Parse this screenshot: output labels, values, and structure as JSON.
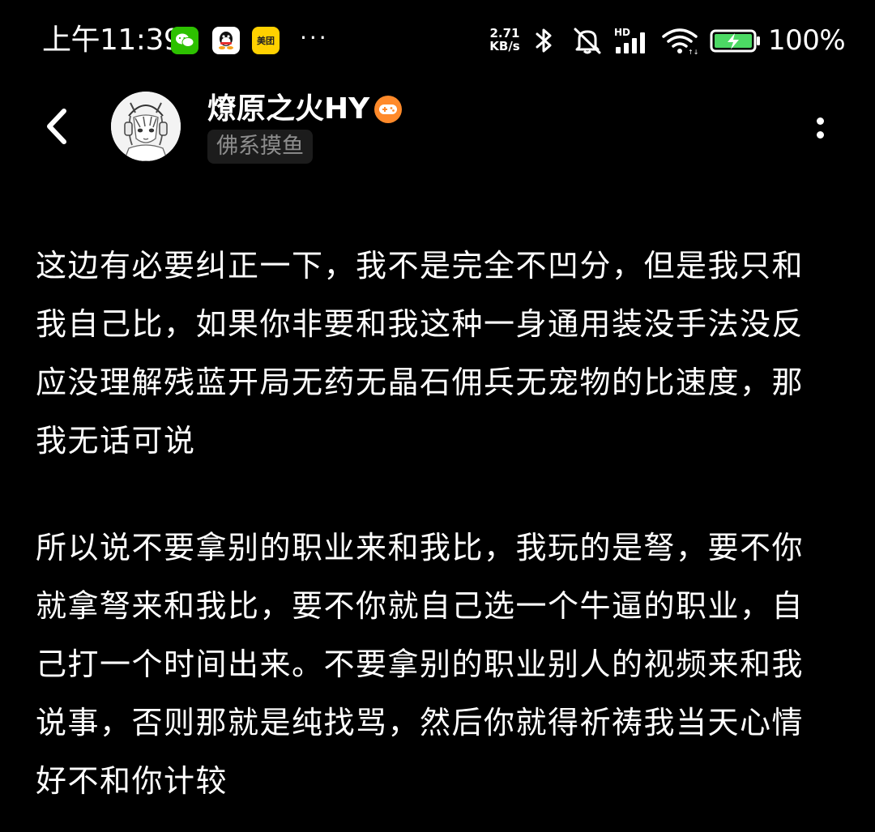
{
  "status_bar": {
    "time": "上午11:39",
    "net_speed_value": "2.71",
    "net_speed_unit": "KB/s",
    "signal_label": "HD",
    "battery_percent": "100%",
    "more_indicator": "···",
    "app_icons": [
      "wechat-icon",
      "qq-icon",
      "meituan-icon"
    ],
    "meituan_label": "美团"
  },
  "header": {
    "username": "燎原之火HY",
    "tag": "佛系摸鱼",
    "badge_icon": "gamepad-badge-icon",
    "back_icon": "chevron-left-icon",
    "more_icon": "vertical-dots-icon"
  },
  "post": {
    "paragraphs": [
      "这边有必要纠正一下，我不是完全不凹分，但是我只和我自己比，如果你非要和我这种一身通用装没手法没反应没理解残蓝开局无药无晶石佣兵无宠物的比速度，那我无话可说",
      "所以说不要拿别的职业来和我比，我玩的是弩，要不你就拿弩来和我比，要不你就自己选一个牛逼的职业，自己打一个时间出来。不要拿别的职业别人的视频来和我说事，否则那就是纯找骂，然后你就得祈祷我当天心情好不和你计较"
    ]
  },
  "colors": {
    "background": "#000000",
    "text": "#ffffff",
    "tag_text": "#8d8d8d",
    "tag_bg": "#1c1c1c",
    "badge": "#ff8a2a",
    "battery_fill": "#4cd964"
  }
}
